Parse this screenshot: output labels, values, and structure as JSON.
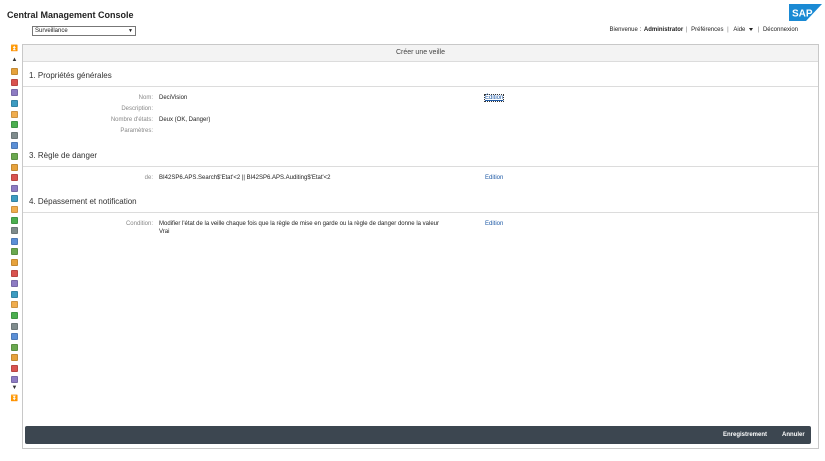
{
  "header": {
    "app_title": "Central Management Console",
    "logo_text": "SAP",
    "workspace_select": "Surveillance",
    "user_bar": {
      "welcome": "Bienvenue :",
      "user": "Administrator",
      "preferences": "Préférences",
      "help": "Aide",
      "logout": "Déconnexion"
    }
  },
  "panel": {
    "title": "Créer une veille",
    "sections": [
      {
        "title": "1. Propriétés générales",
        "fields": [
          {
            "label": "Nom:",
            "value": "DeciVision"
          },
          {
            "label": "Description:",
            "value": ""
          },
          {
            "label": "Nombre d'états:",
            "value": "Deux (OK, Danger)"
          },
          {
            "label": "Paramètres:",
            "value": ""
          }
        ],
        "edit_label": "Édition"
      },
      {
        "title": "3. Règle de danger",
        "fields": [
          {
            "label": "de:",
            "value": "BI42SP6.APS.Search$'Etat'<2 || BI42SP6.APS.Auditing$'Etat'<2"
          }
        ],
        "edit_label": "Edition"
      },
      {
        "title": "4. Dépassement et notification",
        "fields": [
          {
            "label": "Condition:",
            "value_line1": "Modifier l'état de la veille chaque fois que la règle de mise en garde ou la règle de danger donne la valeur",
            "value_line2": "Vrai"
          }
        ],
        "edit_label": "Edition"
      }
    ],
    "footer": {
      "save": "Enregistrement",
      "cancel": "Annuler"
    }
  },
  "colors": {
    "accent_link": "#1f5aa6",
    "footer_bg": "#3c4650",
    "sap_blue": "#1a8ad4"
  },
  "rail_icons": [
    "scroll-top-icon",
    "scroll-up-icon",
    "calendar-icon",
    "folder-icon",
    "calendar2-icon",
    "users-icon",
    "server-icon",
    "group-icon",
    "help-icon",
    "key-icon",
    "box-icon",
    "grid-icon",
    "list-icon",
    "lock-icon",
    "document-icon",
    "gear-icon",
    "chart-icon",
    "info-icon",
    "warning-icon",
    "settings-icon",
    "tag-icon",
    "tree-icon",
    "pie-icon",
    "heart-icon",
    "plugin-icon",
    "network-icon",
    "clock-icon",
    "brace-icon",
    "calendar3-icon",
    "monitor-icon",
    "star-icon",
    "report-icon",
    "scroll-down-icon",
    "scroll-bottom-icon"
  ]
}
